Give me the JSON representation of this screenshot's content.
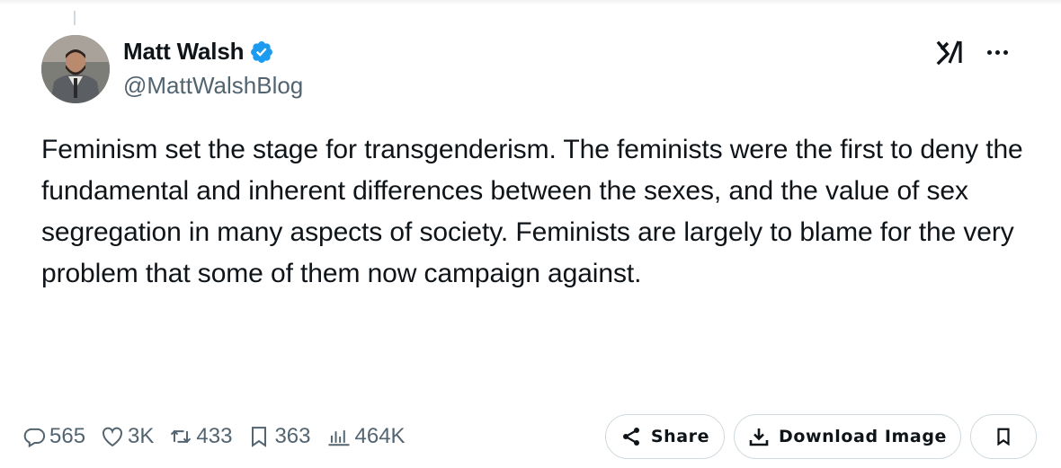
{
  "author": {
    "display_name": "Matt Walsh",
    "handle": "@MattWalshBlog",
    "verified": true,
    "verified_color": "#1d9bf0",
    "avatar_icon": "avatar-photo"
  },
  "tweet": {
    "text": "Feminism set the stage for transgenderism. The feminists were the first to deny the fundamental and inherent differences between the sexes, and the value of sex segregation in many aspects of society. Feminists are largely to blame for the very problem that some of them now campaign against."
  },
  "metrics": {
    "replies": "565",
    "likes": "3K",
    "reposts": "433",
    "bookmarks": "363",
    "views": "464K"
  },
  "actions": {
    "share_label": "Share",
    "download_label": "Download Image"
  },
  "colors": {
    "text_primary": "#0f1419",
    "text_secondary": "#536471",
    "border": "#cfd9de"
  }
}
